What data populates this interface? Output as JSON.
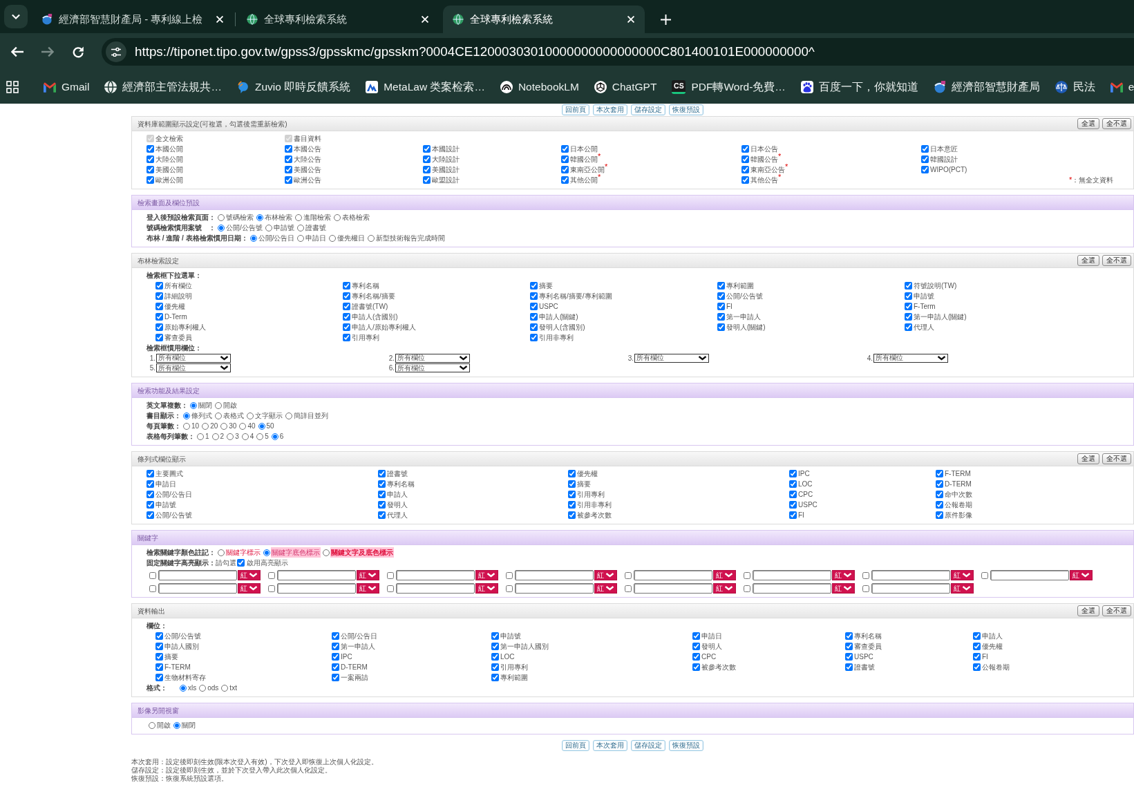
{
  "browser": {
    "tabs": [
      {
        "title": "經濟部智慧財產局 - 專利線上檢",
        "selected": false
      },
      {
        "title": "全球專利檢索系統",
        "selected": false
      },
      {
        "title": "全球專利檢索系統",
        "selected": true
      }
    ],
    "forward_disabled": true,
    "url": "https://tiponet.tipo.gov.tw/gpss3/gpsskmc/gpsskm?0004CE12000303010000000000000000C801400101E000000000^",
    "bookmarks": [
      {
        "label": "Gmail"
      },
      {
        "label": "經濟部主管法規共…"
      },
      {
        "label": "Zuvio 即時反饋系統"
      },
      {
        "label": "MetaLaw 类案检索…"
      },
      {
        "label": "NotebookLM"
      },
      {
        "label": "ChatGPT"
      },
      {
        "label": "PDF轉Word-免費…",
        "logo_text": "CS"
      },
      {
        "label": "百度一下，你就知道"
      },
      {
        "label": "經濟部智慧財產局"
      },
      {
        "label": "民法"
      },
      {
        "label": "e"
      }
    ]
  },
  "top_buttons": [
    "回前頁",
    "本次套用",
    "儲存設定",
    "恢復預設"
  ],
  "sections": [
    {
      "title": "資料庫範圍顯示設定(可複選，勾選後需重新檢索)",
      "kind": "plain",
      "header_buttons": [
        "全選",
        "全不選"
      ],
      "blocks": [
        {
          "kind": "checks",
          "rows": [
            [
              {
                "label": "全文檢索",
                "checked": true,
                "disabled": true
              },
              {
                "label": "書目資料",
                "checked": true,
                "disabled": true
              }
            ]
          ]
        },
        {
          "kind": "checks",
          "rows": [
            [
              {
                "label": "本國公開",
                "checked": true
              },
              {
                "label": "本國公告",
                "checked": true
              },
              {
                "label": "本國設計",
                "checked": true
              },
              {
                "label": "日本公開",
                "checked": true
              },
              {
                "label": "日本公告",
                "checked": true
              },
              {
                "label": "日本意匠",
                "checked": true
              }
            ],
            [
              {
                "label": "大陸公開",
                "checked": true
              },
              {
                "label": "大陸公告",
                "checked": true
              },
              {
                "label": "大陸設計",
                "checked": true
              },
              {
                "label": "韓國公開$^{*}$",
                "checked": true
              },
              {
                "label": "韓國公告$^{*}$",
                "checked": true
              },
              {
                "label": "韓國設計",
                "checked": true
              }
            ],
            [
              {
                "label": "美國公開",
                "checked": true
              },
              {
                "label": "美國公告",
                "checked": true
              },
              {
                "label": "美國設計",
                "checked": true
              },
              {
                "label": "東南亞公開$^{*}$",
                "checked": true
              },
              {
                "label": "東南亞公告$^{*}$",
                "checked": true
              },
              {
                "label": "WIPO(PCT)",
                "checked": true
              }
            ],
            [
              {
                "label": "歐洲公開",
                "checked": true
              },
              {
                "label": "歐洲公告",
                "checked": true
              },
              {
                "label": "歐盟設計",
                "checked": true
              },
              {
                "label": "其他公開$^{*}$",
                "checked": true
              },
              {
                "label": "其他公告$^{*}$",
                "checked": true
              }
            ]
          ],
          "legend": {
            "symbol": "*",
            "text": "：無全文資料"
          }
        }
      ]
    },
    {
      "title": "檢索畫面及欄位預設",
      "kind": "accent",
      "blocks": [
        {
          "kind": "radios",
          "label": "登入後預設檢索頁面：",
          "options": [
            {
              "label": "號碼檢索",
              "selected": false
            },
            {
              "label": "布林檢索",
              "selected": true
            },
            {
              "label": "進階檢索",
              "selected": false
            },
            {
              "label": "表格檢索",
              "selected": false
            }
          ]
        },
        {
          "kind": "radios",
          "label": "號碼檢索慣用案號　：",
          "options": [
            {
              "label": "公開/公告號",
              "selected": true
            },
            {
              "label": "申請號",
              "selected": false
            },
            {
              "label": "證書號",
              "selected": false
            }
          ]
        },
        {
          "kind": "radios",
          "label": "布林 / 進階 / 表格檢索慣用日期：",
          "options": [
            {
              "label": "公開/公告日",
              "selected": true
            },
            {
              "label": "申請日",
              "selected": false
            },
            {
              "label": "優先權日",
              "selected": false
            },
            {
              "label": "新型技術報告完成時間",
              "selected": false
            }
          ]
        }
      ]
    },
    {
      "title": "布林檢索設定",
      "kind": "plain",
      "header_buttons": [
        "全選",
        "全不選"
      ],
      "blocks": [
        {
          "kind": "heading",
          "text": "檢索框下拉選單："
        },
        {
          "kind": "checks",
          "rows": [
            [
              {
                "label": "所有欄位",
                "checked": true
              },
              {
                "label": "專利名稱",
                "checked": true
              },
              {
                "label": "摘要",
                "checked": true
              },
              {
                "label": "專利範圍",
                "checked": true
              },
              {
                "label": "符號說明(TW)",
                "checked": true
              }
            ],
            [
              {
                "label": "詳細說明",
                "checked": true
              },
              {
                "label": "專利名稱/摘要",
                "checked": true
              },
              {
                "label": "專利名稱/摘要/專利範圍",
                "checked": true
              },
              {
                "label": "公開/公告號",
                "checked": true
              },
              {
                "label": "申請號",
                "checked": true
              }
            ],
            [
              {
                "label": "優先權",
                "checked": true
              },
              {
                "label": "證書號(TW)",
                "checked": true
              },
              {
                "label": "USPC",
                "checked": true
              },
              {
                "label": "FI",
                "checked": true
              },
              {
                "label": "F-Term",
                "checked": true
              }
            ],
            [
              {
                "label": "D-Term",
                "checked": true
              },
              {
                "label": "申請人(含國別)",
                "checked": true
              },
              {
                "label": "申請人(關鍵)",
                "checked": true
              },
              {
                "label": "第一申請人",
                "checked": true
              },
              {
                "label": "第一申請人(關鍵)",
                "checked": true
              }
            ],
            [
              {
                "label": "原始專利權人",
                "checked": true
              },
              {
                "label": "申請人/原始專利權人",
                "checked": true
              },
              {
                "label": "發明人(含國別)",
                "checked": true
              },
              {
                "label": "發明人(關鍵)",
                "checked": true
              },
              {
                "label": "代理人",
                "checked": true
              }
            ],
            [
              {
                "label": "審查委員",
                "checked": true
              },
              {
                "label": "引用專利",
                "checked": true
              },
              {
                "label": "引用非專利",
                "checked": true
              }
            ]
          ]
        },
        {
          "kind": "heading",
          "text": "檢索框慣用欄位："
        },
        {
          "kind": "selects",
          "items": [
            {
              "number": "1.",
              "value": "所有欄位"
            },
            {
              "number": "2.",
              "value": "所有欄位"
            },
            {
              "number": "3.",
              "value": "所有欄位"
            },
            {
              "number": "4.",
              "value": "所有欄位"
            },
            {
              "number": "5.",
              "value": "所有欄位"
            },
            {
              "number": "6.",
              "value": "所有欄位"
            }
          ]
        }
      ]
    },
    {
      "title": "檢索功能及結果設定",
      "kind": "accent",
      "blocks": [
        {
          "kind": "radios",
          "label": "英文單複數：",
          "options": [
            {
              "label": "關閉",
              "selected": true
            },
            {
              "label": "開啟",
              "selected": false
            }
          ]
        },
        {
          "kind": "radios",
          "label": "書目顯示：",
          "options": [
            {
              "label": "條列式",
              "selected": true
            },
            {
              "label": "表格式",
              "selected": false
            },
            {
              "label": "文字顯示",
              "selected": false
            },
            {
              "label": "簡詳目並列",
              "selected": false
            }
          ]
        },
        {
          "kind": "radios",
          "label": "每頁筆數：",
          "options": [
            {
              "label": "10",
              "selected": false
            },
            {
              "label": "20",
              "selected": false
            },
            {
              "label": "30",
              "selected": false
            },
            {
              "label": "40",
              "selected": false
            },
            {
              "label": "50",
              "selected": true
            }
          ]
        },
        {
          "kind": "radios",
          "label": "表格每列筆數：",
          "options": [
            {
              "label": "1",
              "selected": false
            },
            {
              "label": "2",
              "selected": false
            },
            {
              "label": "3",
              "selected": false
            },
            {
              "label": "4",
              "selected": false
            },
            {
              "label": "5",
              "selected": false
            },
            {
              "label": "6",
              "selected": true
            }
          ]
        }
      ]
    },
    {
      "title": "條列式欄位顯示",
      "kind": "plain",
      "header_buttons": [
        "全選",
        "全不選"
      ],
      "blocks": [
        {
          "kind": "checks",
          "rows": [
            [
              {
                "label": "主要圖式",
                "checked": true
              },
              {
                "label": "證書號",
                "checked": true
              },
              {
                "label": "優先權",
                "checked": true
              },
              {
                "label": "IPC",
                "checked": true
              },
              {
                "label": "F-TERM",
                "checked": true
              }
            ],
            [
              {
                "label": "申請日",
                "checked": true
              },
              {
                "label": "專利名稱",
                "checked": true
              },
              {
                "label": "摘要",
                "checked": true
              },
              {
                "label": "LOC",
                "checked": true
              },
              {
                "label": "D-TERM",
                "checked": true
              }
            ],
            [
              {
                "label": "公開/公告日",
                "checked": true
              },
              {
                "label": "申請人",
                "checked": true
              },
              {
                "label": "引用專利",
                "checked": true
              },
              {
                "label": "CPC",
                "checked": true
              },
              {
                "label": "命中次數",
                "checked": true
              }
            ],
            [
              {
                "label": "申請號",
                "checked": true
              },
              {
                "label": "發明人",
                "checked": true
              },
              {
                "label": "引用非專利",
                "checked": true
              },
              {
                "label": "USPC",
                "checked": true
              },
              {
                "label": "公報卷期",
                "checked": true
              }
            ],
            [
              {
                "label": "公開/公告號",
                "checked": true
              },
              {
                "label": "代理人",
                "checked": true
              },
              {
                "label": "被參考次數",
                "checked": true
              },
              {
                "label": "FI",
                "checked": true
              },
              {
                "label": "原件影像",
                "checked": true
              }
            ]
          ]
        }
      ]
    },
    {
      "title": "關鍵字",
      "kind": "accent",
      "blocks": [
        {
          "kind": "radios",
          "label": "檢索關鍵字顏色註記：",
          "options": [
            {
              "label": "關鍵字標示",
              "selected": false,
              "kind": "text"
            },
            {
              "label": "關鍵字底色標示",
              "selected": true,
              "kind": "shade"
            },
            {
              "label": "關鍵文字及底色標示",
              "selected": false,
              "kind": "both"
            }
          ]
        },
        {
          "kind": "toggle",
          "label": "**固定關鍵字高亮顯示：**請勾選",
          "checked": true,
          "text": "啟用高亮顯示"
        },
        {
          "kind": "keywords",
          "rows": [
            [
              {
                "checked": false,
                "option": "紅"
              },
              {
                "checked": false,
                "option": "紅"
              },
              {
                "checked": false,
                "option": "紅"
              },
              {
                "checked": false,
                "option": "紅"
              },
              {
                "checked": false,
                "option": "紅"
              },
              {
                "checked": false,
                "option": "紅"
              },
              {
                "checked": false,
                "option": "紅"
              },
              {
                "checked": false,
                "option": "紅"
              }
            ],
            [
              {
                "checked": false,
                "option": "紅"
              },
              {
                "checked": false,
                "option": "紅"
              },
              {
                "checked": false,
                "option": "紅"
              },
              {
                "checked": false,
                "option": "紅"
              },
              {
                "checked": false,
                "option": "紅"
              },
              {
                "checked": false,
                "option": "紅"
              },
              {
                "checked": false,
                "option": "紅"
              }
            ]
          ]
        }
      ]
    },
    {
      "title": "資料輸出",
      "kind": "plain",
      "header_buttons": [
        "全選",
        "全不選"
      ],
      "blocks": [
        {
          "kind": "heading",
          "text": "欄位："
        },
        {
          "kind": "checks",
          "rows": [
            [
              {
                "label": "公開/公告號",
                "checked": true
              },
              {
                "label": "公開/公告日",
                "checked": true
              },
              {
                "label": "申請號",
                "checked": true
              },
              {
                "label": "申請日",
                "checked": true
              },
              {
                "label": "專利名稱",
                "checked": true
              },
              {
                "label": "申請人",
                "checked": true
              }
            ],
            [
              {
                "label": "申請人國別",
                "checked": true
              },
              {
                "label": "第一申請人",
                "checked": true
              },
              {
                "label": "第一申請人國別",
                "checked": true
              },
              {
                "label": "發明人",
                "checked": true
              },
              {
                "label": "審查委員",
                "checked": true
              },
              {
                "label": "優先權",
                "checked": true
              }
            ],
            [
              {
                "label": "摘要",
                "checked": true
              },
              {
                "label": "IPC",
                "checked": true
              },
              {
                "label": "LOC",
                "checked": true
              },
              {
                "label": "CPC",
                "checked": true
              },
              {
                "label": "USPC",
                "checked": true
              },
              {
                "label": "FI",
                "checked": true
              }
            ],
            [
              {
                "label": "F-TERM",
                "checked": true
              },
              {
                "label": "D-TERM",
                "checked": true
              },
              {
                "label": "引用專利",
                "checked": true
              },
              {
                "label": "被參考次數",
                "checked": true
              },
              {
                "label": "證書號",
                "checked": true
              },
              {
                "label": "公報卷期",
                "checked": true
              }
            ],
            [
              {
                "label": "生物材料寄存",
                "checked": true
              },
              {
                "label": "一案兩請",
                "checked": true
              },
              {
                "label": "專利範圍",
                "checked": true
              }
            ]
          ]
        },
        {
          "kind": "radios",
          "label": "格式：",
          "options": [
            {
              "label": "xls",
              "selected": true
            },
            {
              "label": "ods",
              "selected": false
            },
            {
              "label": "txt",
              "selected": false
            }
          ]
        }
      ]
    },
    {
      "title": "影像另開視窗",
      "kind": "accent",
      "blocks": [
        {
          "kind": "radios",
          "options": [
            {
              "label": "開啟",
              "selected": false
            },
            {
              "label": "關閉",
              "selected": true
            }
          ]
        }
      ]
    }
  ],
  "bottom_buttons": [
    "回前頁",
    "本次套用",
    "儲存設定",
    "恢復預設"
  ],
  "notes": [
    "本次套用：設定後即刻生效(限本次登入有效)，下次登入即恢復上次個人化設定。",
    "儲存設定：設定後即刻生效，並於下次登入帶入此次個人化設定。",
    "恢復預設：恢復系統預設選項。"
  ]
}
